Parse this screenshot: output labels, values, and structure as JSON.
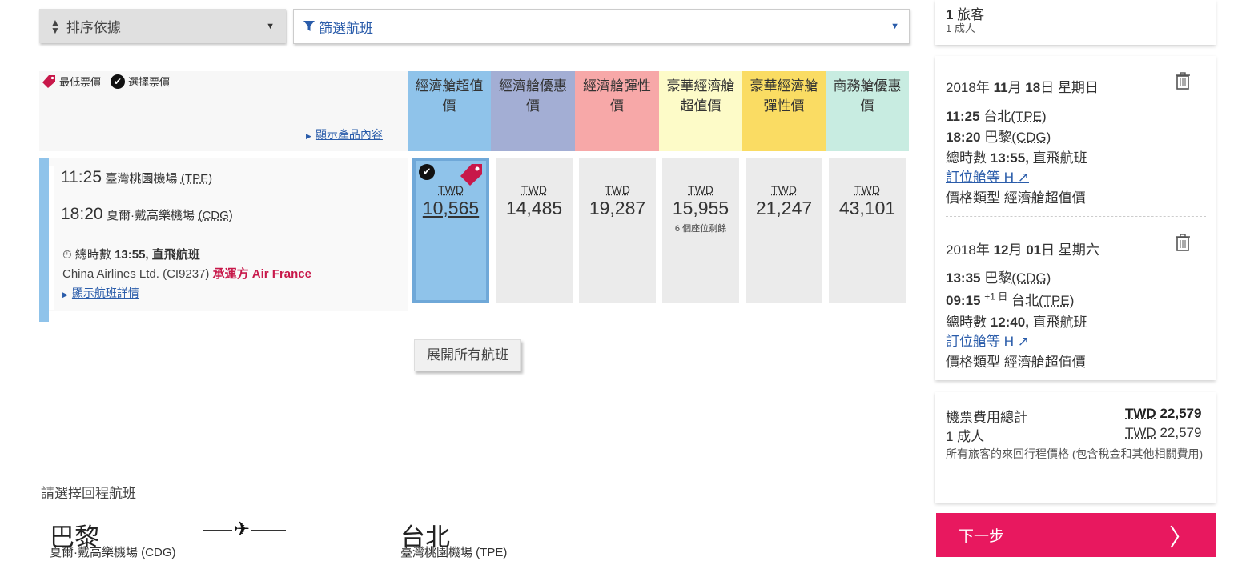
{
  "sort": {
    "label": "排序依據",
    "icon": "sort-icon"
  },
  "filter": {
    "label": "篩選航班",
    "icon": "funnel-icon"
  },
  "legend": {
    "lowest": "最低票價",
    "selected": "選擇票價"
  },
  "show_product": "顯示產品內容",
  "columns": [
    {
      "label": "經濟艙超值價",
      "color": "#8fc3ea"
    },
    {
      "label": "經濟艙優惠價",
      "color": "#a3aed4"
    },
    {
      "label": "經濟艙彈性價",
      "color": "#f7a8a8"
    },
    {
      "label": "豪華經濟艙超值價",
      "color": "#fdfbc8"
    },
    {
      "label": "豪華經濟艙彈性價",
      "color": "#fadc63"
    },
    {
      "label": "商務艙優惠價",
      "color": "#c8ece1"
    }
  ],
  "flight": {
    "dep_time": "11:25",
    "dep_airport": "臺灣桃園機場",
    "dep_code": "(TPE)",
    "arr_time": "18:20",
    "arr_airport": "夏爾·戴高樂機場",
    "arr_code": "(CDG)",
    "duration_label": "總時數",
    "duration": "13:55,",
    "nonstop": "直飛航班",
    "carrier": "China Airlines Ltd. (CI9237)",
    "operated_by": "承運方",
    "operator": "Air France",
    "show_details": "顯示航班詳情"
  },
  "fares": [
    {
      "currency": "TWD",
      "amount": "10,565",
      "seats": ""
    },
    {
      "currency": "TWD",
      "amount": "14,485",
      "seats": ""
    },
    {
      "currency": "TWD",
      "amount": "19,287",
      "seats": ""
    },
    {
      "currency": "TWD",
      "amount": "15,955",
      "seats": "6 個座位剩餘"
    },
    {
      "currency": "TWD",
      "amount": "21,247",
      "seats": ""
    },
    {
      "currency": "TWD",
      "amount": "43,101",
      "seats": ""
    }
  ],
  "expand_all": "展開所有航班",
  "return": {
    "label": "請選擇回程航班",
    "from_city": "巴黎",
    "from_airport": "夏爾·戴高樂機場 (CDG)",
    "to_city": "台北",
    "to_airport": "臺灣桃園機場 (TPE)"
  },
  "summary": {
    "pax_count": "1",
    "pax_label": "旅客",
    "pax_sub": "1 成人",
    "segments": [
      {
        "date_y": "2018",
        "y": "年",
        "date_m": "11",
        "m": "月",
        "date_d": "18",
        "d": "日",
        "weekday": "星期日",
        "dep_time": "11:25",
        "dep_city": "台北",
        "dep_code": "(TPE)",
        "arr_time": "18:20",
        "arr_plus": "",
        "arr_city": "巴黎",
        "arr_code": "(CDG)",
        "dur_label": "總時數",
        "duration": "13:55,",
        "nonstop": "直飛航班",
        "booking_class": "訂位艙等 H",
        "fare_type_label": "價格類型",
        "fare_type": "經濟艙超值價"
      },
      {
        "date_y": "2018",
        "y": "年",
        "date_m": "12",
        "m": "月",
        "date_d": "01",
        "d": "日",
        "weekday": "星期六",
        "dep_time": "13:35",
        "dep_city": "巴黎",
        "dep_code": "(CDG)",
        "arr_time": "09:15",
        "arr_plus": "+1 日",
        "arr_city": "台北",
        "arr_code": "(TPE)",
        "dur_label": "總時數",
        "duration": "12:40,",
        "nonstop": "直飛航班",
        "booking_class": "訂位艙等 H",
        "fare_type_label": "價格類型",
        "fare_type": "經濟艙超值價"
      }
    ],
    "total_label": "機票費用總計",
    "total_currency": "TWD",
    "total_amount": "22,579",
    "adult_label": "1 成人",
    "adult_currency": "TWD",
    "adult_amount": "22,579",
    "note": "所有旅客的來回行程價格 (包含稅金和其他相關費用)",
    "next": "下一步"
  },
  "colors": {
    "accent": "#e8185f",
    "link": "#2a5caa",
    "selected_fare": "#8fc3ea"
  }
}
